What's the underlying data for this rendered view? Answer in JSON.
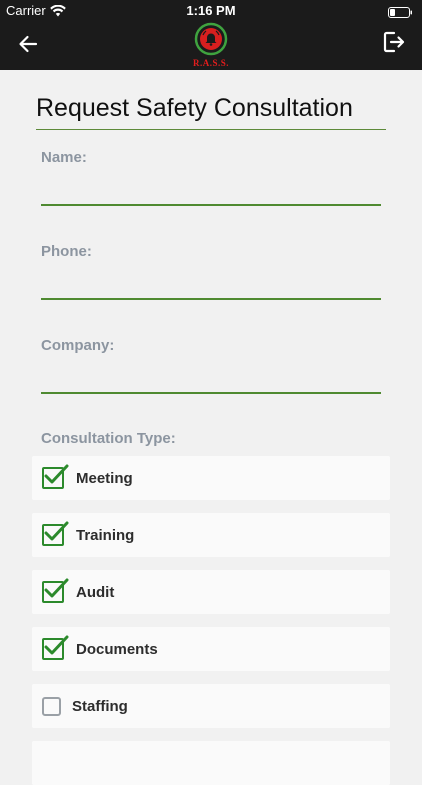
{
  "status_bar": {
    "carrier": "Carrier",
    "time": "1:16 PM"
  },
  "header": {
    "logo_text": "R.A.S.S.",
    "back_icon": "arrow-left-icon",
    "logout_icon": "logout-icon"
  },
  "page": {
    "title": "Request Safety Consultation"
  },
  "form": {
    "name_label": "Name:",
    "name_value": "",
    "phone_label": "Phone:",
    "phone_value": "",
    "company_label": "Company:",
    "company_value": "",
    "consultation_type_label": "Consultation Type:",
    "options": [
      {
        "label": "Meeting",
        "checked": true
      },
      {
        "label": "Training",
        "checked": true
      },
      {
        "label": "Audit",
        "checked": true
      },
      {
        "label": "Documents",
        "checked": true
      },
      {
        "label": "Staffing",
        "checked": false
      }
    ]
  },
  "colors": {
    "header_bg": "#1b1b1b",
    "accent_green": "#4f8a31",
    "check_green": "#2c8a2c",
    "logo_red": "#e11d1d",
    "label_gray": "#8c95a0"
  }
}
